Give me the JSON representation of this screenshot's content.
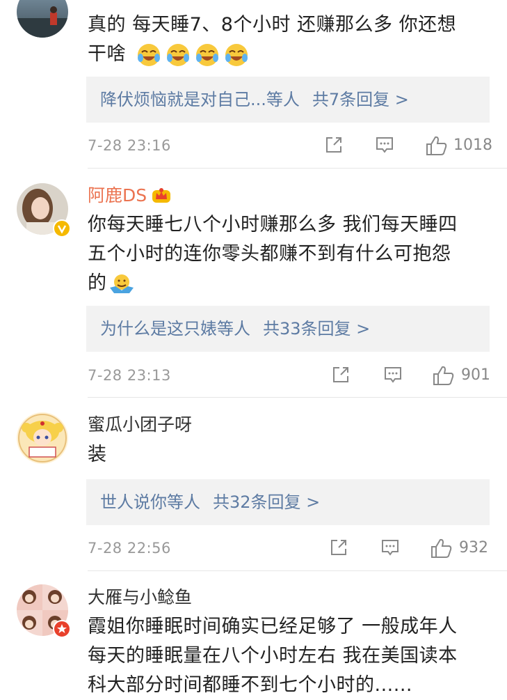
{
  "comments": [
    {
      "username": "",
      "text_line1": "真的 每天睡7、8个小时 还赚那么多 你还想",
      "text_line2": "干啥",
      "reply_first": "降伏烦恼就是对自己...等人",
      "reply_count": "共7条回复 >",
      "time": "7-28 23:16",
      "likes": "1018"
    },
    {
      "username": "阿鹿DS",
      "text_line1": "你每天睡七八个小时赚那么多 我们每天睡四",
      "text_line2": "五个小时的连你零头都赚不到有什么可抱怨",
      "text_line3": "的",
      "reply_first": "为什么是这只婊等人",
      "reply_count": "共33条回复 >",
      "time": "7-28 23:13",
      "likes": "901"
    },
    {
      "username": "蜜瓜小团子呀",
      "text_line1": "装",
      "reply_first": "世人说你等人",
      "reply_count": "共32条回复 >",
      "time": "7-28 22:56",
      "likes": "932"
    },
    {
      "username": "大雁与小鲶鱼",
      "text_line1": "霞姐你睡眠时间确实已经足够了 一般成年人",
      "text_line2": "每天的睡眠量在八个小时左右 我在美国读本",
      "text_line3": "科大部分时间都睡不到七个小时的......"
    }
  ]
}
